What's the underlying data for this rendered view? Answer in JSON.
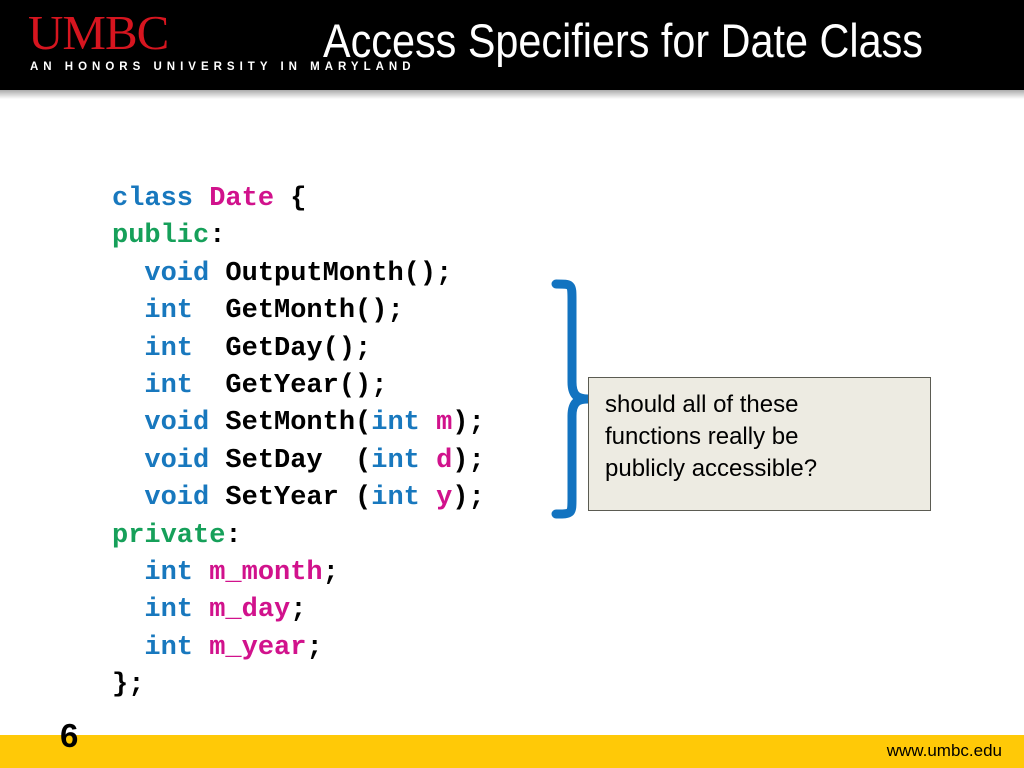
{
  "slide": {
    "page_number": "6",
    "title": "Access Specifiers for Date Class"
  },
  "branding": {
    "wordmark": "UMBC",
    "tagline": "AN HONORS UNIVERSITY IN MARYLAND",
    "footer_url": "www.umbc.edu",
    "logo_red": "#D6151F",
    "footer_gold": "#FFC907",
    "header_black": "#000000"
  },
  "code": {
    "language": "C++",
    "colors": {
      "keyword": "#1878BE",
      "access_specifier": "#16A05A",
      "identifier": "#D1128C",
      "plain": "#000000"
    },
    "lines": [
      [
        {
          "t": "class",
          "c": "kw"
        },
        {
          "t": " ",
          "c": "plain"
        },
        {
          "t": "Date",
          "c": "type"
        },
        {
          "t": " {",
          "c": "plain"
        }
      ],
      [
        {
          "t": "public",
          "c": "acc"
        },
        {
          "t": ":",
          "c": "plain"
        }
      ],
      [
        {
          "t": "  ",
          "c": "plain"
        },
        {
          "t": "void",
          "c": "kw"
        },
        {
          "t": " OutputMonth();",
          "c": "plain"
        }
      ],
      [
        {
          "t": "  ",
          "c": "plain"
        },
        {
          "t": "int",
          "c": "kw"
        },
        {
          "t": "  GetMonth();",
          "c": "plain"
        }
      ],
      [
        {
          "t": "  ",
          "c": "plain"
        },
        {
          "t": "int",
          "c": "kw"
        },
        {
          "t": "  GetDay();",
          "c": "plain"
        }
      ],
      [
        {
          "t": "  ",
          "c": "plain"
        },
        {
          "t": "int",
          "c": "kw"
        },
        {
          "t": "  GetYear();",
          "c": "plain"
        }
      ],
      [
        {
          "t": "  ",
          "c": "plain"
        },
        {
          "t": "void",
          "c": "kw"
        },
        {
          "t": " SetMonth(",
          "c": "plain"
        },
        {
          "t": "int",
          "c": "kw"
        },
        {
          "t": " ",
          "c": "plain"
        },
        {
          "t": "m",
          "c": "type"
        },
        {
          "t": ");",
          "c": "plain"
        }
      ],
      [
        {
          "t": "  ",
          "c": "plain"
        },
        {
          "t": "void",
          "c": "kw"
        },
        {
          "t": " SetDay  (",
          "c": "plain"
        },
        {
          "t": "int",
          "c": "kw"
        },
        {
          "t": " ",
          "c": "plain"
        },
        {
          "t": "d",
          "c": "type"
        },
        {
          "t": ");",
          "c": "plain"
        }
      ],
      [
        {
          "t": "  ",
          "c": "plain"
        },
        {
          "t": "void",
          "c": "kw"
        },
        {
          "t": " SetYear (",
          "c": "plain"
        },
        {
          "t": "int",
          "c": "kw"
        },
        {
          "t": " ",
          "c": "plain"
        },
        {
          "t": "y",
          "c": "type"
        },
        {
          "t": ");",
          "c": "plain"
        }
      ],
      [
        {
          "t": "private",
          "c": "acc"
        },
        {
          "t": ":",
          "c": "plain"
        }
      ],
      [
        {
          "t": "  ",
          "c": "plain"
        },
        {
          "t": "int",
          "c": "kw"
        },
        {
          "t": " ",
          "c": "plain"
        },
        {
          "t": "m_month",
          "c": "type"
        },
        {
          "t": ";",
          "c": "plain"
        }
      ],
      [
        {
          "t": "  ",
          "c": "plain"
        },
        {
          "t": "int",
          "c": "kw"
        },
        {
          "t": " ",
          "c": "plain"
        },
        {
          "t": "m_day",
          "c": "type"
        },
        {
          "t": ";",
          "c": "plain"
        }
      ],
      [
        {
          "t": "  ",
          "c": "plain"
        },
        {
          "t": "int",
          "c": "kw"
        },
        {
          "t": " ",
          "c": "plain"
        },
        {
          "t": "m_year",
          "c": "type"
        },
        {
          "t": ";",
          "c": "plain"
        }
      ],
      [
        {
          "t": "};",
          "c": "plain"
        }
      ]
    ]
  },
  "callout": {
    "text": "should all of these\nfunctions really be\npublicly accessible?",
    "background": "#EDEBE2",
    "border_color": "#5B5B52",
    "connector_color": "#1273C0",
    "connector_shape": "right-curly-brace"
  }
}
